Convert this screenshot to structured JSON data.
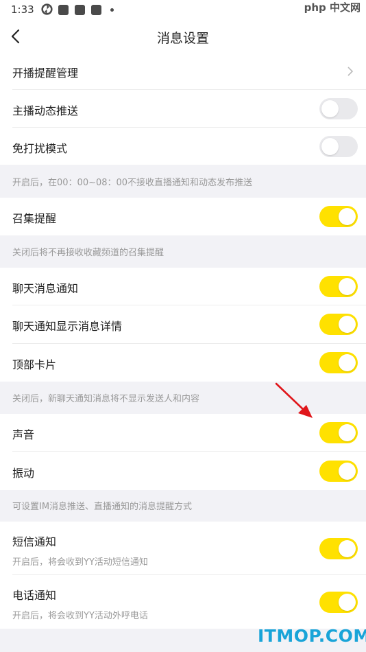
{
  "status_bar": {
    "time": "1:33"
  },
  "watermark_top": "php 中文网",
  "header": {
    "title": "消息设置"
  },
  "settings": {
    "live_reminder": "开播提醒管理",
    "anchor_push": {
      "label": "主播动态推送",
      "on": false
    },
    "dnd": {
      "label": "免打扰模式",
      "on": false
    },
    "dnd_note": "开启后，在00：00~08：00不接收直播通知和动态发布推送",
    "summon": {
      "label": "召集提醒",
      "on": true
    },
    "summon_note": "关闭后将不再接收收藏频道的召集提醒",
    "chat_notify": {
      "label": "聊天消息通知",
      "on": true
    },
    "chat_detail": {
      "label": "聊天通知显示消息详情",
      "on": true
    },
    "top_card": {
      "label": "顶部卡片",
      "on": true
    },
    "chat_note": "关闭后，新聊天通知消息将不显示发送人和内容",
    "sound": {
      "label": "声音",
      "on": true
    },
    "vibrate": {
      "label": "振动",
      "on": true
    },
    "im_note": "可设置IM消息推送、直播通知的消息提醒方式",
    "sms": {
      "label": "短信通知",
      "sub": "开启后，将会收到YY活动短信通知",
      "on": true
    },
    "phone": {
      "label": "电话通知",
      "sub": "开启后，将会收到YY活动外呼电话",
      "on": true
    }
  },
  "colors": {
    "toggle_on": "#ffe100",
    "toggle_off": "#e9e9ec",
    "background": "#f2f2f6",
    "arrow": "#e0161b"
  },
  "watermark_bottom": "ITMOP.COM"
}
